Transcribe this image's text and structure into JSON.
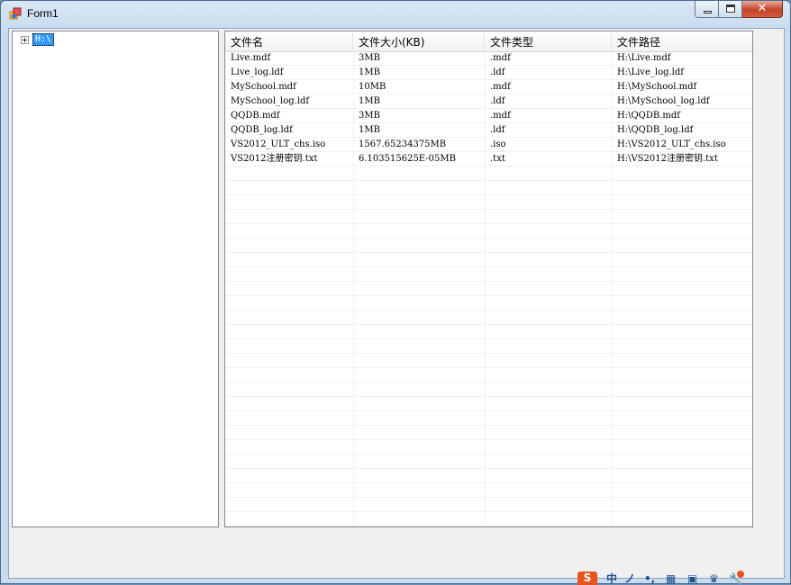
{
  "window": {
    "title": "Form1",
    "close_glyph": "✕"
  },
  "tree": {
    "root": {
      "label": "H:\\",
      "expanded": false,
      "selected": true
    }
  },
  "listview": {
    "columns": [
      "文件名",
      "文件大小(KB)",
      "文件类型",
      "文件路径"
    ],
    "rows": [
      [
        "Live.mdf",
        "3MB",
        ".mdf",
        "H:\\Live.mdf"
      ],
      [
        "Live_log.ldf",
        "1MB",
        ".ldf",
        "H:\\Live_log.ldf"
      ],
      [
        "MySchool.mdf",
        "10MB",
        ".mdf",
        "H:\\MySchool.mdf"
      ],
      [
        "MySchool_log.ldf",
        "1MB",
        ".ldf",
        "H:\\MySchool_log.ldf"
      ],
      [
        "QQDB.mdf",
        "3MB",
        ".mdf",
        "H:\\QQDB.mdf"
      ],
      [
        "QQDB_log.ldf",
        "1MB",
        ".ldf",
        "H:\\QQDB_log.ldf"
      ],
      [
        "VS2012_ULT_chs.iso",
        "1567.65234375MB",
        ".iso",
        "H:\\VS2012_ULT_chs.iso"
      ],
      [
        "VS2012注册密钥.txt",
        "6.103515625E-05MB",
        ".txt",
        "H:\\VS2012注册密钥.txt"
      ]
    ]
  },
  "ime_toolbar": {
    "logo": "S",
    "lang": "中",
    "icons": [
      "ime-logo-icon",
      "chinese-mode-icon",
      "moon-icon",
      "punctuation-icon",
      "keyboard-icon",
      "toolbox-icon",
      "shirt-icon",
      "wrench-icon"
    ],
    "glyphs": [
      "ノ",
      "•,",
      "▦",
      "▣",
      "♛",
      "🔧"
    ],
    "accent": "#e8541e"
  }
}
